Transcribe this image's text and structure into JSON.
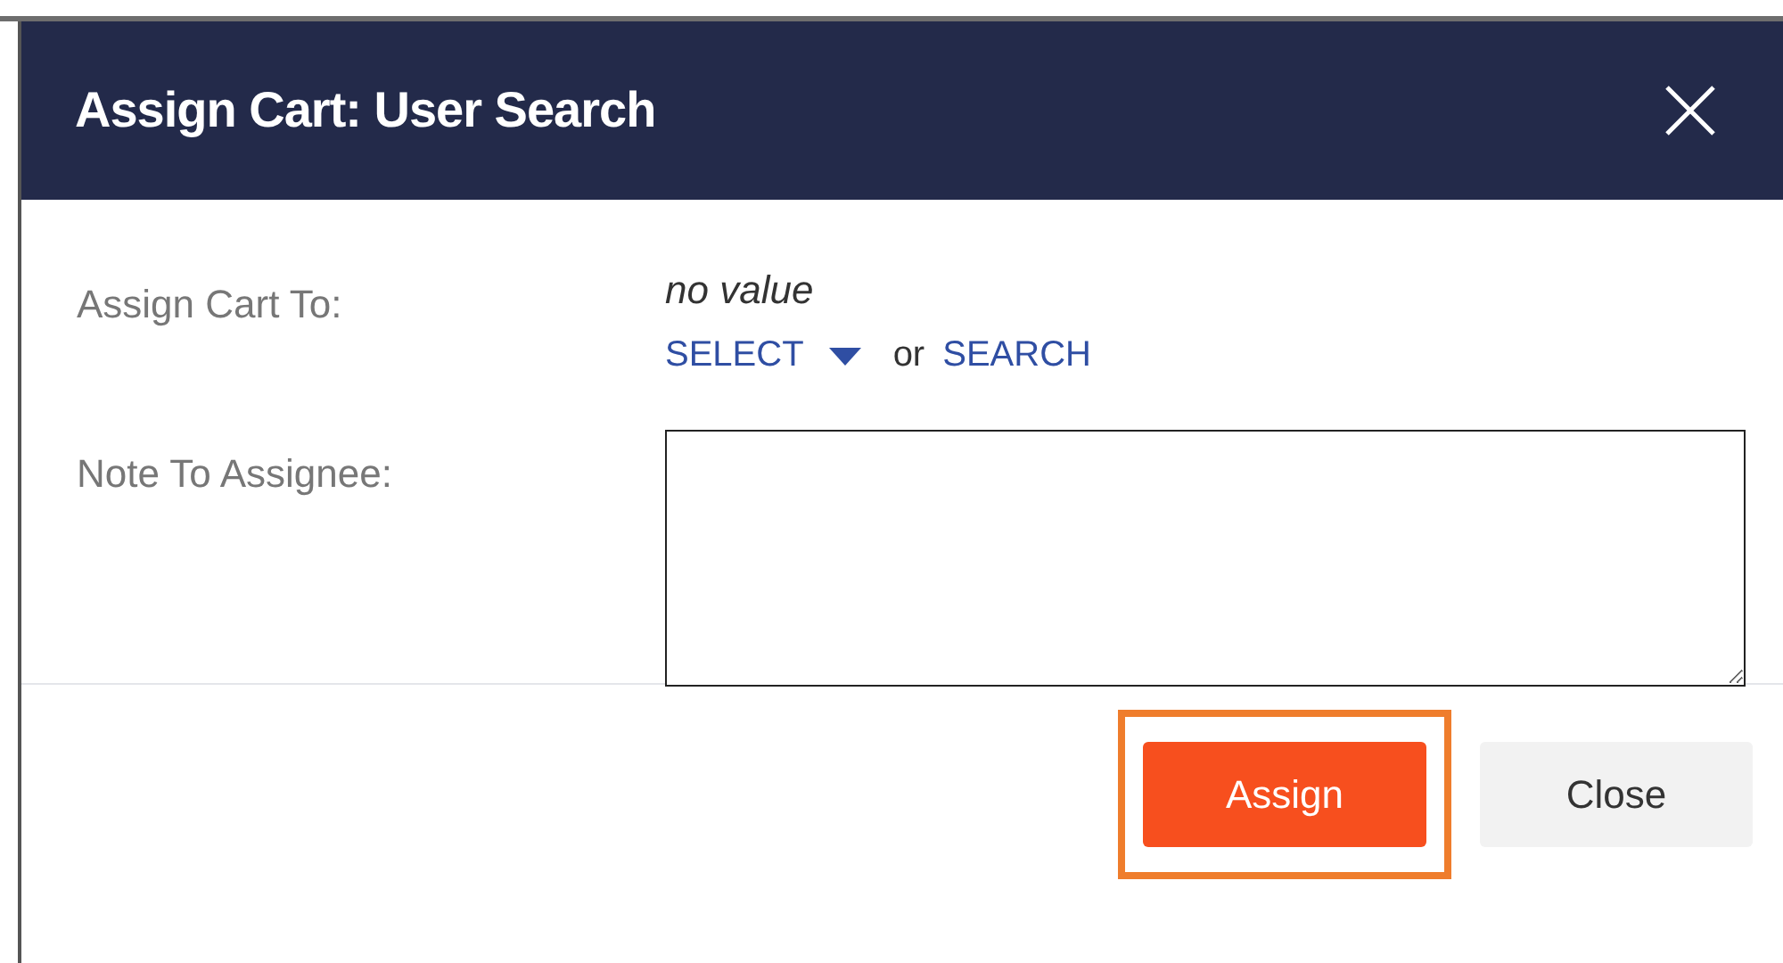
{
  "dialog": {
    "title": "Assign Cart: User Search"
  },
  "fields": [
    {
      "kind": "choice",
      "label": "Assign Cart To:",
      "value": "no value",
      "select_link": "SELECT",
      "separator": "or",
      "search_link": "SEARCH"
    },
    {
      "kind": "textarea",
      "label": "Note To Assignee:",
      "focused": true
    }
  ],
  "buttons": [
    {
      "label": "Assign",
      "kind": "primary",
      "highlighted": true
    },
    {
      "label": "Close",
      "kind": "secondary",
      "highlighted": false
    }
  ]
}
